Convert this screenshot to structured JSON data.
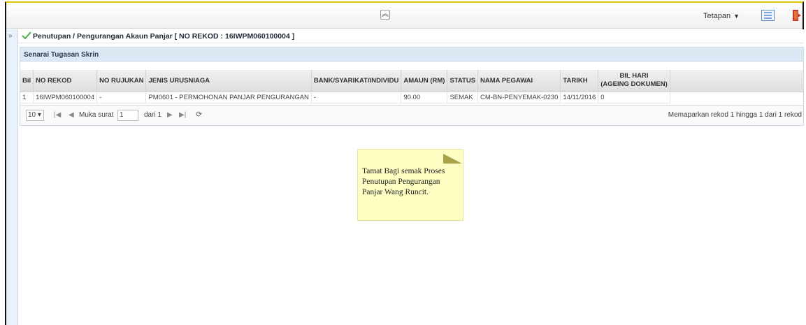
{
  "toolbar": {
    "settings_label": "Tetapan",
    "collapse_glyph": "︽",
    "expand_glyph": "»"
  },
  "header": {
    "title": "Penutupan / Pengurangan Akaun Panjar [ NO REKOD : 16IWPM060100004 ]"
  },
  "panel": {
    "title": "Senarai Tugasan Skrin"
  },
  "table": {
    "columns": [
      "Bil",
      "NO REKOD",
      "NO RUJUKAN",
      "JENIS URUSNIAGA",
      "BANK/SYARIKAT/INDIVIDU",
      "AMAUN (RM)",
      "STATUS",
      "NAMA PEGAWAI",
      "TARIKH",
      "BIL HARI",
      "(AGEING DOKUMEN)"
    ],
    "rows": [
      {
        "bil": "1",
        "no_rekod": "16IWPM060100004",
        "no_rujukan": "-",
        "jenis_urusniaga": "PM0601 - PERMOHONAN PANJAR PENGURANGAN",
        "bank": "-",
        "amaun": "90.00",
        "status": "SEMAK",
        "nama_pegawai": "CM-BN-PENYEMAK-0230",
        "tarikh": "14/11/2016",
        "bil_hari": "0"
      }
    ]
  },
  "pager": {
    "rows_per_page": "10",
    "page_label": "Muka surat",
    "page_value": "1",
    "of_label": "dari 1",
    "summary": "Memaparkan rekod 1 hingga 1 dari 1 rekod"
  },
  "note": {
    "text": "Tamat Bagi semak Proses Penutupan Pengurangan Panjar Wang Runcit."
  },
  "colors": {
    "panel_header": "#dce9f5",
    "note_bg": "#ffffc4",
    "top_border": "#e4c200"
  },
  "icons": [
    "collapse-icon",
    "settings-dropdown",
    "list-view-icon",
    "exit-icon",
    "expand-icon",
    "check-icon",
    "first-page-icon",
    "prev-page-icon",
    "next-page-icon",
    "last-page-icon",
    "refresh-icon"
  ]
}
